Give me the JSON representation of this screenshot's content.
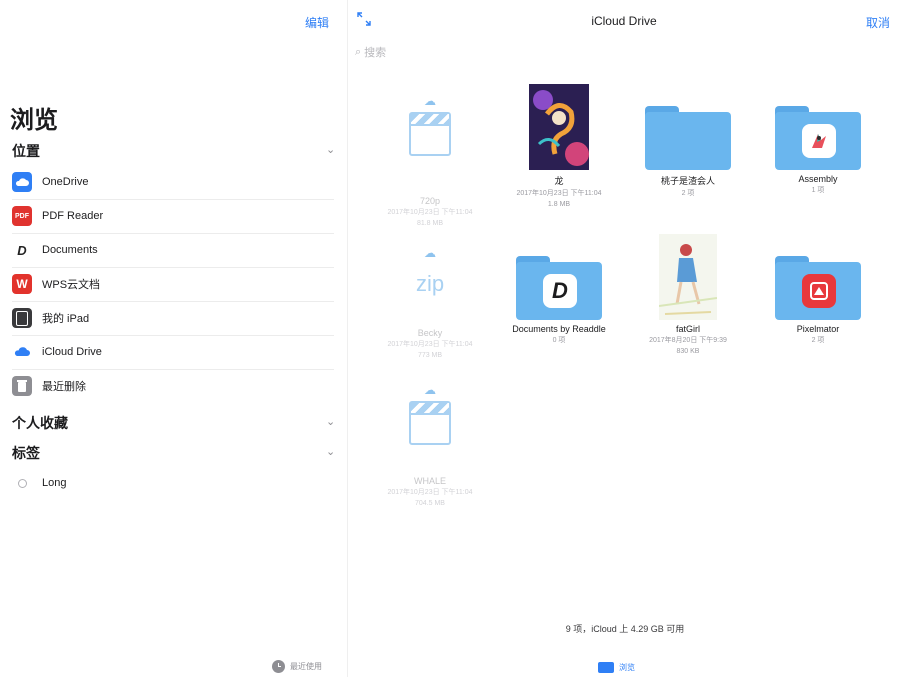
{
  "sidebar": {
    "edit_label": "编辑",
    "title": "浏览",
    "locations_header": "位置",
    "locations": [
      {
        "label": "OneDrive",
        "icon": "onedrive-icon",
        "color": "#2f7ff5"
      },
      {
        "label": "PDF Reader",
        "icon": "pdf-reader-icon",
        "color": "#e0332f"
      },
      {
        "label": "Documents",
        "icon": "documents-icon",
        "color": "#ffffff"
      },
      {
        "label": "WPS云文档",
        "icon": "wps-icon",
        "color": "#e2332c"
      },
      {
        "label": "我的 iPad",
        "icon": "ipad-icon",
        "color": "#3a3a3c"
      },
      {
        "label": "iCloud Drive",
        "icon": "icloud-icon",
        "color": "#2f7ff5"
      },
      {
        "label": "最近删除",
        "icon": "trash-icon",
        "color": "#8e8e93"
      }
    ],
    "favorites_header": "个人收藏",
    "tags_header": "标签",
    "tags": [
      {
        "label": "Long"
      }
    ]
  },
  "header": {
    "title": "iCloud Drive",
    "cancel_label": "取消",
    "search_placeholder": "搜索"
  },
  "files": [
    {
      "name": "720p",
      "meta1": "2017年10月23日 下午11:04",
      "meta2": "81.8 MB",
      "type": "video",
      "faded": true
    },
    {
      "name": "龙",
      "meta1": "2017年10月23日 下午11:04",
      "meta2": "1.8 MB",
      "type": "image"
    },
    {
      "name": "桃子是渣会人",
      "meta1": "2 项",
      "type": "folder"
    },
    {
      "name": "Assembly",
      "meta1": "1 项",
      "type": "folder-app"
    },
    {
      "name": "Becky",
      "meta1": "2017年10月23日 下午11:04",
      "meta2": "773 MB",
      "type": "zip",
      "faded": true
    },
    {
      "name": "Documents by Readdle",
      "meta1": "0 项",
      "type": "folder-app"
    },
    {
      "name": "fatGirl",
      "meta1": "2017年8月20日 下午9:39",
      "meta2": "830 KB",
      "type": "image"
    },
    {
      "name": "Pixelmator",
      "meta1": "2 项",
      "type": "folder-app"
    },
    {
      "name": "WHALE",
      "meta1": "2017年10月23日 下午11:04",
      "meta2": "704.5 MB",
      "type": "video",
      "faded": true
    }
  ],
  "zip_label": "zip",
  "status": "9 项，iCloud 上 4.29 GB 可用",
  "tabbar": {
    "recent_label": "最近使用",
    "browse_label": "浏览"
  },
  "colors": {
    "accent": "#2f7ff5",
    "folder": "#6ab6ee"
  }
}
